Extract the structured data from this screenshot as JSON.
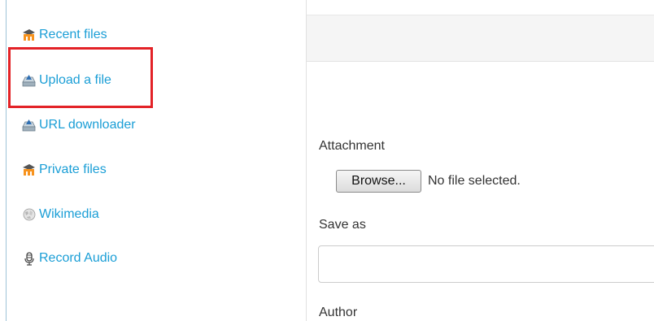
{
  "sidebar": {
    "items": [
      {
        "label": "Recent files",
        "icon": "moodle-logo-icon"
      },
      {
        "label": "Upload a file",
        "icon": "upload-drive-icon"
      },
      {
        "label": "URL downloader",
        "icon": "upload-drive-icon"
      },
      {
        "label": "Private files",
        "icon": "moodle-logo-icon"
      },
      {
        "label": "Wikimedia",
        "icon": "wikipedia-globe-icon"
      },
      {
        "label": "Record Audio",
        "icon": "microphone-icon"
      }
    ]
  },
  "main": {
    "attachment_label": "Attachment",
    "browse_label": "Browse...",
    "file_status": "No file selected.",
    "saveas_label": "Save as",
    "saveas_value": "",
    "author_label": "Author"
  },
  "colors": {
    "link": "#1a9ed6",
    "highlight_border": "#e32227",
    "moodle_orange": "#f7931e"
  }
}
